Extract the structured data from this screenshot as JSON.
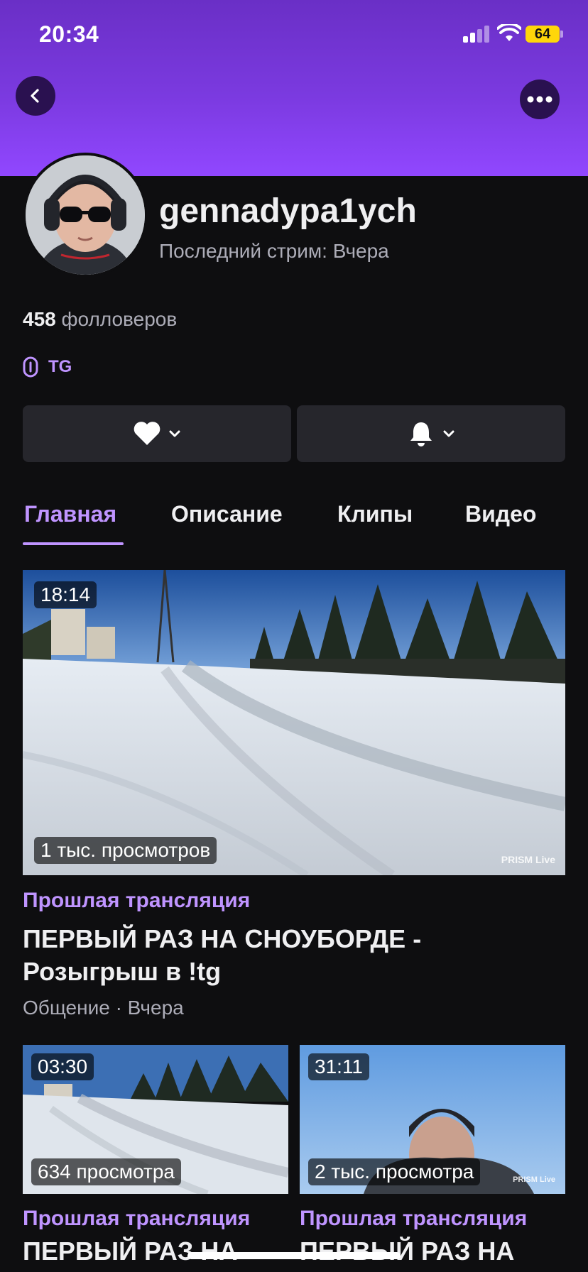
{
  "status_bar": {
    "time": "20:34",
    "battery": "64"
  },
  "channel": {
    "username": "gennadypa1ych",
    "last_stream": "Последний стрим: Вчера",
    "followers_count": "458",
    "followers_label": "фолловеров",
    "link_label": "TG"
  },
  "icons": {
    "back": "chevron-left-icon",
    "more": "more-horizontal-icon",
    "link": "link-icon",
    "follow": "heart-icon",
    "notify": "bell-icon"
  },
  "tabs": [
    {
      "label": "Главная",
      "active": true
    },
    {
      "label": "Описание",
      "active": false
    },
    {
      "label": "Клипы",
      "active": false
    },
    {
      "label": "Видео",
      "active": false
    }
  ],
  "featured_video": {
    "duration": "18:14",
    "views": "1 тыс. просмотров",
    "watermark": "PRISM Live",
    "category": "Прошлая трансляция",
    "title_line1": "ПЕРВЫЙ РАЗ НА СНОУБОРДЕ -",
    "title_line2": "Розыгрыш в !tg",
    "meta": "Общение · Вчера"
  },
  "videos": [
    {
      "duration": "03:30",
      "views": "634 просмотра",
      "category": "Прошлая трансляция",
      "title": "ПЕРВЫЙ РАЗ НА"
    },
    {
      "duration": "31:11",
      "views": "2 тыс. просмотра",
      "category": "Прошлая трансляция",
      "title": "ПЕРВЫЙ РАЗ НА",
      "watermark": "PRISM Live"
    }
  ],
  "colors": {
    "accent": "#bf94ff",
    "header_top": "#6a2fc6",
    "header_bottom": "#9147ff",
    "background": "#0e0e10",
    "button_bg": "#26262c"
  }
}
